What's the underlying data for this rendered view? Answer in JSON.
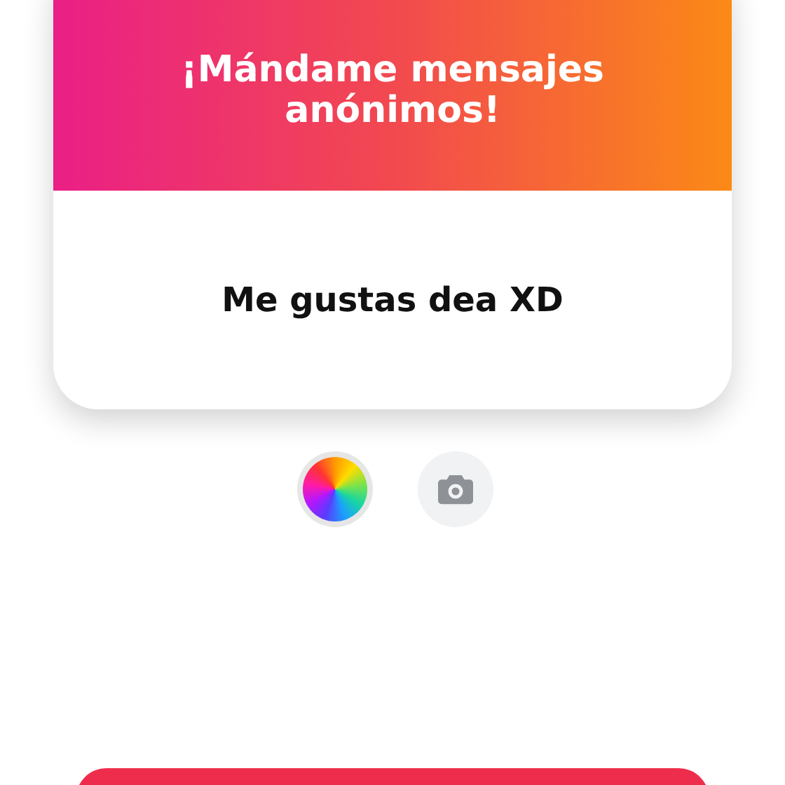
{
  "card": {
    "title": "¡Mándame mensajes anónimos!",
    "message": "Me gustas dea XD"
  },
  "tools": [
    {
      "kind": "color"
    },
    {
      "kind": "camera"
    }
  ]
}
